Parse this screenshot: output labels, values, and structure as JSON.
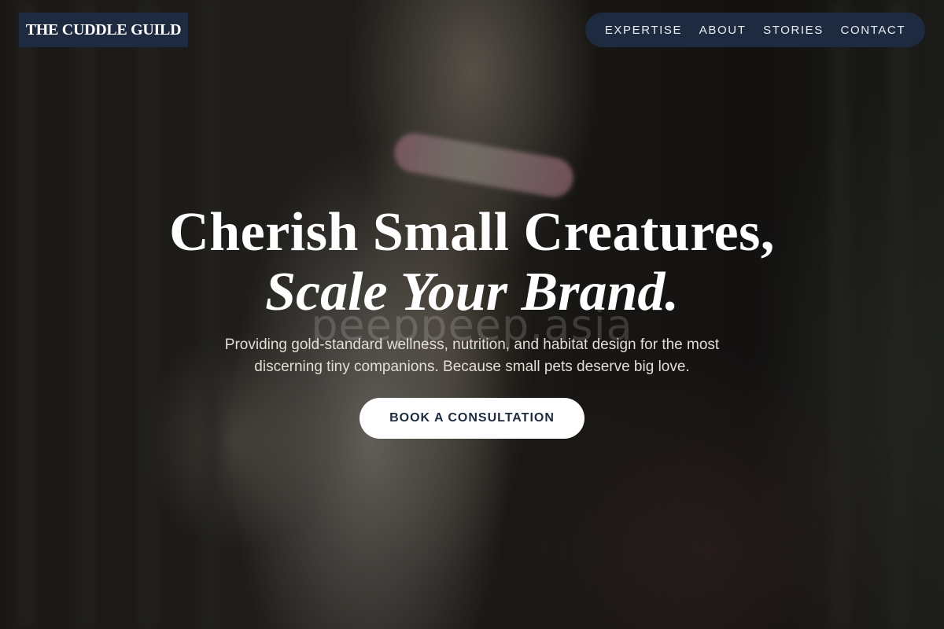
{
  "brand": {
    "name": "THE CUDDLE GUILD"
  },
  "nav": {
    "items": [
      {
        "label": "EXPERTISE"
      },
      {
        "label": "ABOUT"
      },
      {
        "label": "STORIES"
      },
      {
        "label": "CONTACT"
      }
    ]
  },
  "hero": {
    "headline_line1": "Cherish Small Creatures,",
    "headline_line2": "Scale Your Brand.",
    "watermark": "peeppeep.asia",
    "subtitle": "Providing gold-standard wellness, nutrition, and habitat design for the most discerning tiny companions. Because small pets deserve big love.",
    "cta_label": "BOOK A CONSULTATION"
  },
  "colors": {
    "header_bg": "#1d2a3f",
    "cta_bg": "#ffffff",
    "cta_text": "#1d2a3f"
  }
}
